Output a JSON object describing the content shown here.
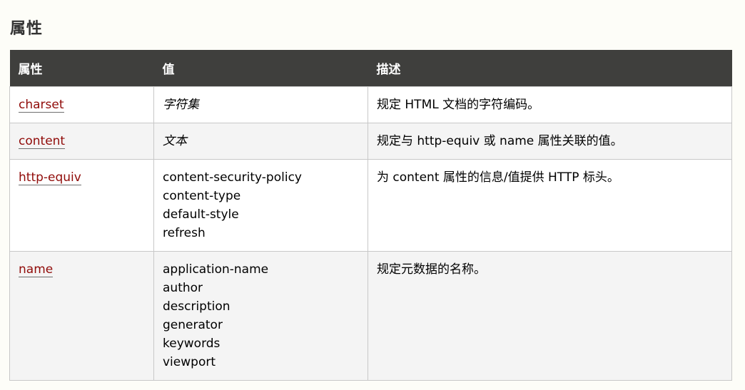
{
  "page": {
    "section_title": "属性"
  },
  "table": {
    "headers": [
      "属性",
      "值",
      "描述"
    ],
    "rows": [
      {
        "attribute": "charset",
        "value_text": "字符集",
        "values": [],
        "description": "规定 HTML 文档的字符编码。"
      },
      {
        "attribute": "content",
        "value_text": "文本",
        "values": [],
        "description": "规定与 http-equiv 或 name 属性关联的值。"
      },
      {
        "attribute": "http-equiv",
        "value_text": "",
        "values": [
          "content-security-policy",
          "content-type",
          "default-style",
          "refresh"
        ],
        "description": "为 content 属性的信息/值提供 HTTP 标头。"
      },
      {
        "attribute": "name",
        "value_text": "",
        "values": [
          "application-name",
          "author",
          "description",
          "generator",
          "keywords",
          "viewport"
        ],
        "description": "规定元数据的名称。"
      }
    ]
  },
  "colors": {
    "header_bg": "#3f3f3d",
    "link": "#900b09",
    "row_alt": "#f4f4f4"
  }
}
